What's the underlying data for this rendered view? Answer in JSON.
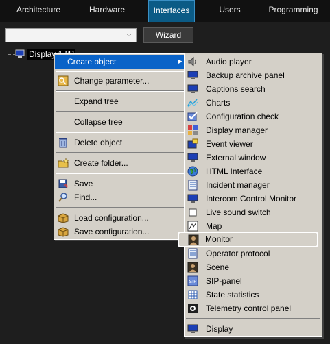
{
  "tabs": [
    "Architecture",
    "Hardware",
    "Interfaces",
    "Users",
    "Programming"
  ],
  "active_tab": "Interfaces",
  "toolbar": {
    "combo_value": "",
    "wizard_label": "Wizard"
  },
  "tree": {
    "node_label": "Display 1 [1]"
  },
  "context_menu": {
    "items": [
      {
        "label": "Create object",
        "icon": "none",
        "submenu_arrow": "▶"
      },
      {
        "label": "Change parameter...",
        "icon": "key-icon"
      },
      {
        "label": "Expand tree",
        "icon": "none"
      },
      {
        "label": "Collapse tree",
        "icon": "none"
      },
      {
        "label": "Delete object",
        "icon": "recycle-bin-icon"
      },
      {
        "label": "Create folder...",
        "icon": "folder-star-icon"
      },
      {
        "label": "Save",
        "icon": "save-icon"
      },
      {
        "label": "Find...",
        "icon": "magnifier-icon"
      },
      {
        "label": "Load configuration...",
        "icon": "box-icon"
      },
      {
        "label": "Save configuration...",
        "icon": "box-icon"
      }
    ]
  },
  "submenu": {
    "items": [
      {
        "label": "Audio player",
        "icon": "speaker-icon"
      },
      {
        "label": "Backup archive panel",
        "icon": "monitor-icon"
      },
      {
        "label": "Captions search",
        "icon": "monitor-icon"
      },
      {
        "label": "Charts",
        "icon": "chart-icon"
      },
      {
        "label": "Configuration check",
        "icon": "checklist-icon"
      },
      {
        "label": "Display manager",
        "icon": "grid-icon"
      },
      {
        "label": "Event viewer",
        "icon": "event-viewer-icon"
      },
      {
        "label": "External window",
        "icon": "monitor-icon"
      },
      {
        "label": "HTML Interface",
        "icon": "globe-icon"
      },
      {
        "label": "Incident manager",
        "icon": "document-icon"
      },
      {
        "label": "Intercom Control Monitor",
        "icon": "monitor-icon"
      },
      {
        "label": "Live sound switch",
        "icon": "square-icon"
      },
      {
        "label": "Map",
        "icon": "map-icon"
      },
      {
        "label": "Monitor",
        "icon": "camera-monitor-icon"
      },
      {
        "label": "Operator protocol",
        "icon": "document-icon"
      },
      {
        "label": "Scene",
        "icon": "scene-icon"
      },
      {
        "label": "SIP-panel",
        "icon": "sip-icon"
      },
      {
        "label": "State statistics",
        "icon": "table-icon"
      },
      {
        "label": "Telemetry control panel",
        "icon": "telemetry-icon"
      },
      {
        "label": "Display",
        "icon": "monitor-icon"
      }
    ],
    "selected": "Monitor"
  },
  "colors": {
    "background": "#1e1e1e",
    "tab_active": "#0b5b86",
    "menu_bg": "#d4d0c8",
    "highlight": "#0a63c8"
  }
}
